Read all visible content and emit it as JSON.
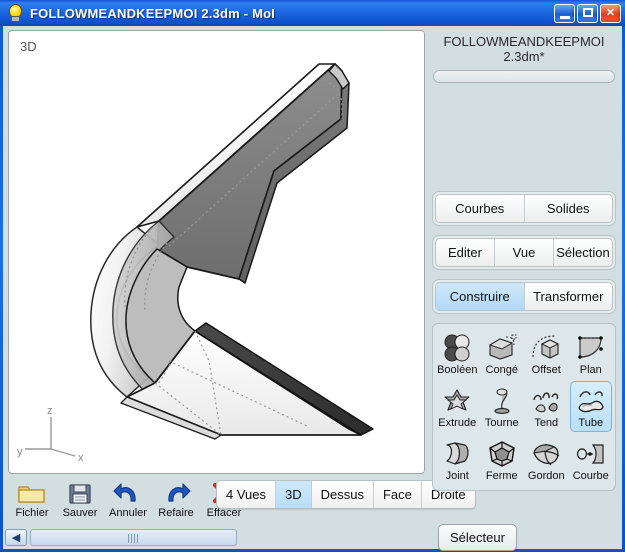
{
  "window": {
    "title": "FOLLOWMEANDKEEPMOI 2.3dm - MoI",
    "app_icon": "lightbulb-icon",
    "controls": {
      "minimize": "minimize-icon",
      "maximize": "maximize-icon",
      "close": "close-icon"
    },
    "accent_color": "#1a6fe8",
    "panel_color": "#d3dee1"
  },
  "viewport": {
    "label": "3D",
    "background": "#ffffff",
    "axes": {
      "x": "x",
      "y": "y",
      "z": "z"
    }
  },
  "document": {
    "name_line1": "FOLLOWMEANDKEEPMOI",
    "name_line2": "2.3dm*"
  },
  "panel": {
    "groups": [
      {
        "name": "object-type-group",
        "buttons": [
          {
            "label": "Courbes",
            "selected": false
          },
          {
            "label": "Solides",
            "selected": false
          }
        ]
      },
      {
        "name": "edit-group",
        "buttons": [
          {
            "label": "Editer",
            "selected": false
          },
          {
            "label": "Vue",
            "selected": false
          },
          {
            "label": "Sélection",
            "selected": false
          }
        ]
      },
      {
        "name": "mode-group",
        "buttons": [
          {
            "label": "Construire",
            "selected": true
          },
          {
            "label": "Transformer",
            "selected": false
          }
        ]
      }
    ],
    "tools": [
      {
        "label": "Booléen",
        "icon": "boolean-icon",
        "selected": false
      },
      {
        "label": "Congé",
        "icon": "fillet-icon",
        "selected": false
      },
      {
        "label": "Offset",
        "icon": "offset-icon",
        "selected": false
      },
      {
        "label": "Plan",
        "icon": "planar-icon",
        "selected": false
      },
      {
        "label": "Extrude",
        "icon": "extrude-icon",
        "selected": false
      },
      {
        "label": "Tourne",
        "icon": "revolve-icon",
        "selected": false
      },
      {
        "label": "Tend",
        "icon": "sweep-icon",
        "selected": false
      },
      {
        "label": "Tube",
        "icon": "tube-icon",
        "selected": true
      },
      {
        "label": "Joint",
        "icon": "loft-icon",
        "selected": false
      },
      {
        "label": "Ferme",
        "icon": "network-icon",
        "selected": false
      },
      {
        "label": "Gordon",
        "icon": "gordon-icon",
        "selected": false
      },
      {
        "label": "Courbe",
        "icon": "curve-icon",
        "selected": false
      }
    ],
    "selector_label": "Sélecteur"
  },
  "toolbar": {
    "buttons": [
      {
        "label": "Fichier",
        "icon": "folder-icon"
      },
      {
        "label": "Sauver",
        "icon": "floppy-disk-icon"
      },
      {
        "label": "Annuler",
        "icon": "undo-arrow-icon"
      },
      {
        "label": "Refaire",
        "icon": "redo-arrow-icon"
      },
      {
        "label": "Effacer",
        "icon": "red-x-icon"
      }
    ],
    "views": [
      {
        "label": "4 Vues",
        "selected": false
      },
      {
        "label": "3D",
        "selected": true
      },
      {
        "label": "Dessus",
        "selected": false
      },
      {
        "label": "Face",
        "selected": false
      },
      {
        "label": "Droite",
        "selected": false
      }
    ]
  },
  "statusbar": {
    "scroll_left_icon": "chevron-left-icon"
  }
}
